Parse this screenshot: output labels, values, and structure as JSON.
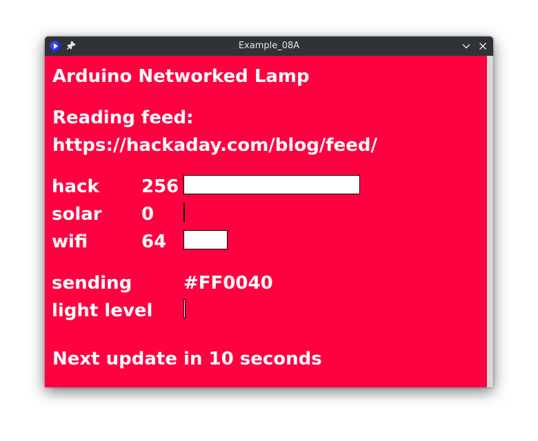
{
  "window": {
    "title": "Example_08A",
    "icons": {
      "app": "processing-app-icon",
      "pin": "pin-icon",
      "minimize": "chevron-down-icon",
      "close": "close-icon"
    }
  },
  "canvas": {
    "background": "#FF0040",
    "heading": "Arduino Networked Lamp",
    "feed_label": "Reading feed:",
    "feed_url": "https://hackaday.com/blog/feed/",
    "counts": [
      {
        "word": "hack",
        "value": "256",
        "level": 1.0
      },
      {
        "word": "solar",
        "value": "0",
        "level": 0.0
      },
      {
        "word": "wifi",
        "value": "64",
        "level": 0.25
      }
    ],
    "sending_label": "sending",
    "sending_value": "#FF0040",
    "light_label": "light level",
    "light_level": 0.0,
    "update_text": "Next update in 10 seconds"
  }
}
